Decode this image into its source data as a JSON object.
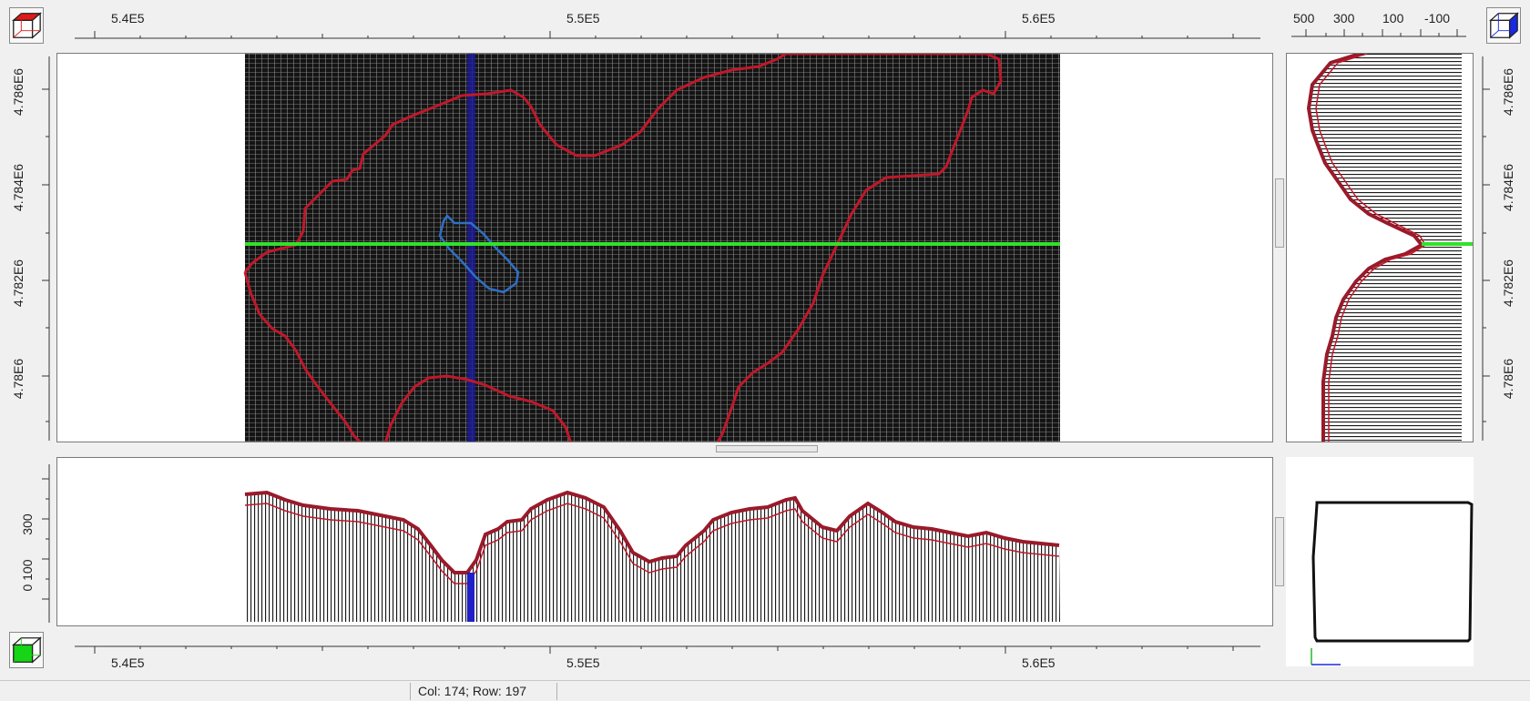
{
  "top_ruler": {
    "labels": [
      "5.4E5",
      "5.5E5",
      "5.6E5"
    ]
  },
  "bottom_ruler": {
    "labels": [
      "5.4E5",
      "5.5E5",
      "5.6E5"
    ]
  },
  "left_ruler": {
    "labels": [
      "4.786E6",
      "4.784E6",
      "4.782E6",
      "4.78E6"
    ]
  },
  "right_ruler": {
    "labels": [
      "4.786E6",
      "4.784E6",
      "4.782E6",
      "4.78E6"
    ]
  },
  "side_profile_ruler": {
    "labels": [
      "500",
      "300",
      "100",
      "-100"
    ]
  },
  "bottom_profile_ruler": {
    "labels": [
      "300",
      "0 100"
    ]
  },
  "status": {
    "cell_text": "Col: 174; Row: 197"
  },
  "colors": {
    "grid_bg": "#141414",
    "contour_red": "#c0182a",
    "contour_blue": "#2f6fc4",
    "row_line_green": "#33e02c",
    "col_line_blue": "#2020c8",
    "cube_red": "#e01a1a",
    "cube_blue": "#1a2ae0",
    "cube_green": "#16d416"
  },
  "icons": {
    "top_left": "red-cube-icon",
    "top_right": "blue-cube-icon",
    "bottom_left": "green-cube-icon",
    "axes": "axes-icon"
  }
}
